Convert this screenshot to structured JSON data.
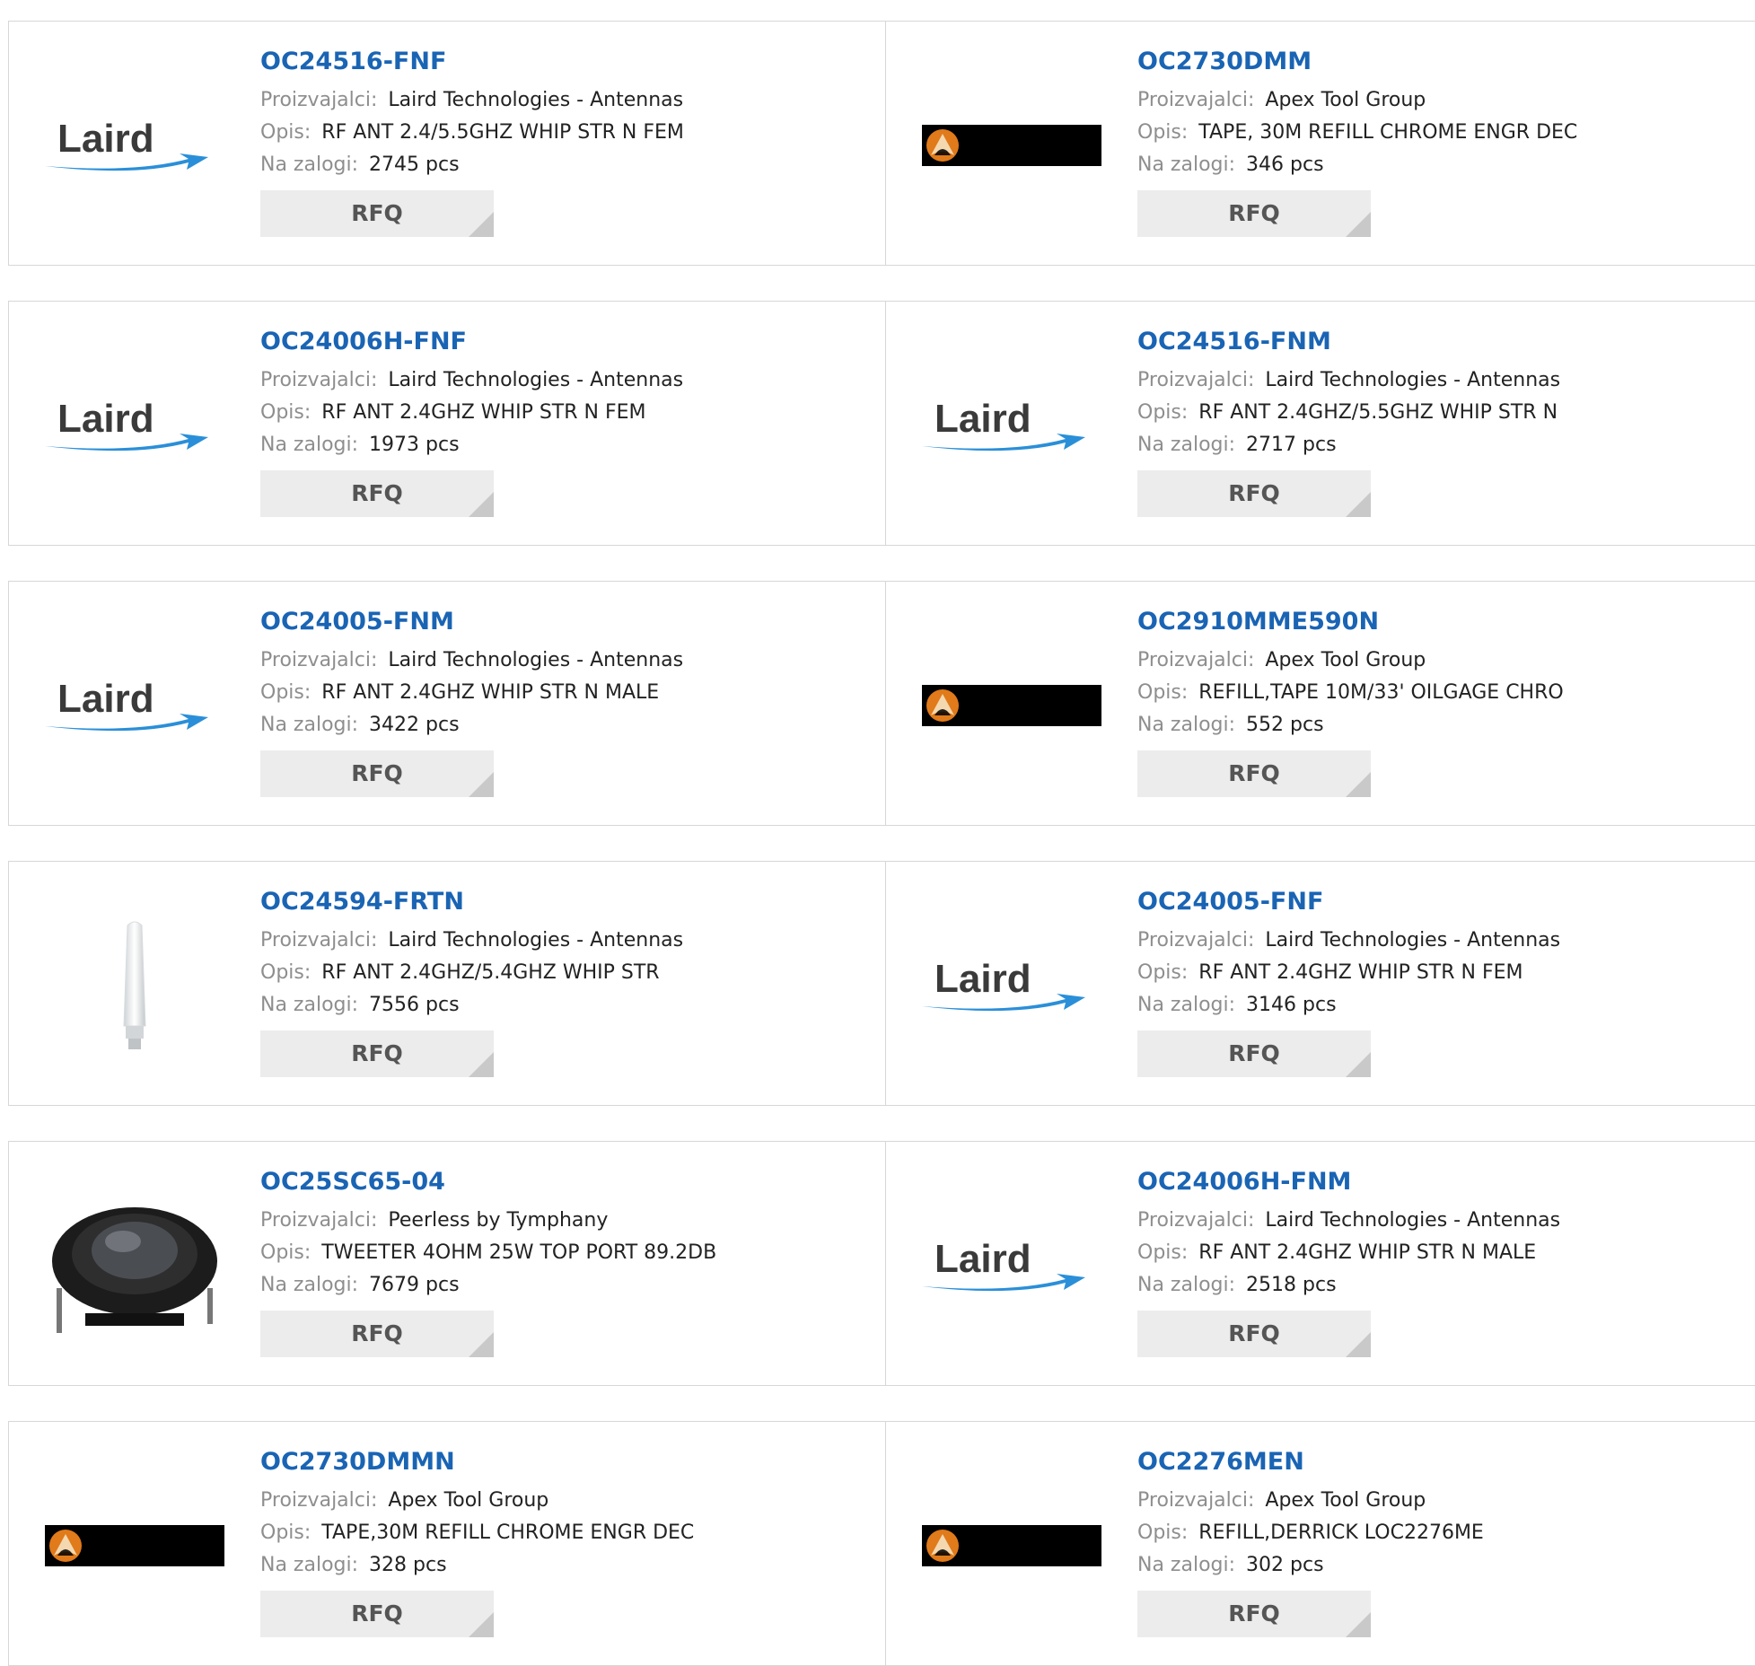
{
  "labels": {
    "manufacturer": "Proizvajalci:",
    "description": "Opis:",
    "stock": "Na zalogi:",
    "rfq": "RFQ"
  },
  "logos": {
    "laird_text": "Laird"
  },
  "colors": {
    "link": "#1a64b4",
    "label": "#8e8e8e",
    "button_bg": "#ececec",
    "border": "#d7d7d7"
  },
  "rows": [
    {
      "left": {
        "part": "OC24516-FNF",
        "manufacturer": "Laird Technologies - Antennas",
        "description": "RF ANT 2.4/5.5GHZ WHIP STR N FEM",
        "stock": "2745 pcs",
        "image": "laird-logo"
      },
      "right": {
        "part": "OC2730DMM",
        "manufacturer": "Apex Tool Group",
        "description": "TAPE, 30M REFILL CHROME ENGR DEC",
        "stock": "346 pcs",
        "image": "apex-logo"
      }
    },
    {
      "left": {
        "part": "OC24006H-FNF",
        "manufacturer": "Laird Technologies - Antennas",
        "description": "RF ANT 2.4GHZ WHIP STR N FEM",
        "stock": "1973 pcs",
        "image": "laird-logo"
      },
      "right": {
        "part": "OC24516-FNM",
        "manufacturer": "Laird Technologies - Antennas",
        "description": "RF ANT 2.4GHZ/5.5GHZ WHIP STR N",
        "stock": "2717 pcs",
        "image": "laird-logo"
      }
    },
    {
      "left": {
        "part": "OC24005-FNM",
        "manufacturer": "Laird Technologies - Antennas",
        "description": "RF ANT 2.4GHZ WHIP STR N MALE",
        "stock": "3422 pcs",
        "image": "laird-logo"
      },
      "right": {
        "part": "OC2910MME590N",
        "manufacturer": "Apex Tool Group",
        "description": "REFILL,TAPE 10M/33' OILGAGE CHRO",
        "stock": "552 pcs",
        "image": "apex-logo"
      }
    },
    {
      "left": {
        "part": "OC24594-FRTN",
        "manufacturer": "Laird Technologies - Antennas",
        "description": "RF ANT 2.4GHZ/5.4GHZ WHIP STR",
        "stock": "7556 pcs",
        "image": "antenna-photo"
      },
      "right": {
        "part": "OC24005-FNF",
        "manufacturer": "Laird Technologies - Antennas",
        "description": "RF ANT 2.4GHZ WHIP STR N FEM",
        "stock": "3146 pcs",
        "image": "laird-logo"
      }
    },
    {
      "left": {
        "part": "OC25SC65-04",
        "manufacturer": "Peerless by Tymphany",
        "description": "TWEETER 4OHM 25W TOP PORT 89.2DB",
        "stock": "7679 pcs",
        "image": "tweeter-photo"
      },
      "right": {
        "part": "OC24006H-FNM",
        "manufacturer": "Laird Technologies - Antennas",
        "description": "RF ANT 2.4GHZ WHIP STR N MALE",
        "stock": "2518 pcs",
        "image": "laird-logo"
      }
    },
    {
      "left": {
        "part": "OC2730DMMN",
        "manufacturer": "Apex Tool Group",
        "description": "TAPE,30M REFILL CHROME ENGR DEC",
        "stock": "328 pcs",
        "image": "apex-logo"
      },
      "right": {
        "part": "OC2276MEN",
        "manufacturer": "Apex Tool Group",
        "description": "REFILL,DERRICK LOC2276ME",
        "stock": "302 pcs",
        "image": "apex-logo"
      }
    }
  ]
}
